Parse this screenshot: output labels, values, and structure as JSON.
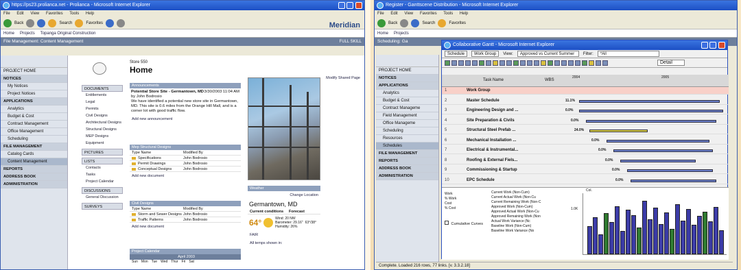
{
  "left_window": {
    "title": "https://ps23.prolianca.net - Prolianca - Microsoft Internet Explorer",
    "menu": [
      "File",
      "Edit",
      "View",
      "Favorites",
      "Tools",
      "Help"
    ],
    "toolbar": {
      "back": "Back",
      "search": "Search",
      "favorites": "Favorites"
    },
    "links": [
      "Home",
      "Projects",
      "Topanga Original Construction"
    ],
    "brand": "Meridian",
    "nav_strip": "File Management: Content Management",
    "nav_right": "FULL SKILL",
    "sidebar": [
      {
        "label": "PROJECT HOME",
        "type": "item"
      },
      {
        "label": "NOTICES",
        "type": "hdr"
      },
      {
        "label": "My Notices",
        "type": "sub"
      },
      {
        "label": "Project Notices",
        "type": "sub"
      },
      {
        "label": "APPLICATIONS",
        "type": "hdr"
      },
      {
        "label": "Analytics",
        "type": "sub"
      },
      {
        "label": "Budget & Cost",
        "type": "sub"
      },
      {
        "label": "Contract Management",
        "type": "sub"
      },
      {
        "label": "Office Management",
        "type": "sub"
      },
      {
        "label": "Scheduling",
        "type": "sub"
      },
      {
        "label": "FILE MANAGEMENT",
        "type": "hdr"
      },
      {
        "label": "Catalog Cards",
        "type": "sub"
      },
      {
        "label": "Content Management",
        "type": "sel"
      },
      {
        "label": "REPORTS",
        "type": "hdr"
      },
      {
        "label": "ADDRESS BOOK",
        "type": "hdr"
      },
      {
        "label": "ADMINISTRATION",
        "type": "hdr"
      }
    ],
    "page_sub": "Store 550",
    "page_title": "Home",
    "modify": "Modify Shared Page",
    "left_nav": [
      {
        "label": "DOCUMENTS",
        "sec": true
      },
      {
        "label": "Entitlements",
        "sec": false
      },
      {
        "label": "Legal",
        "sec": false
      },
      {
        "label": "Permits",
        "sec": false
      },
      {
        "label": "Civil Designs",
        "sec": false
      },
      {
        "label": "Architectural Designs",
        "sec": false
      },
      {
        "label": "Structural Designs",
        "sec": false
      },
      {
        "label": "MEP Designs",
        "sec": false
      },
      {
        "label": "Equipment",
        "sec": false
      },
      {
        "label": "PICTURES",
        "sec": true
      },
      {
        "label": "LISTS",
        "sec": true
      },
      {
        "label": "Contacts",
        "sec": false
      },
      {
        "label": "Tasks",
        "sec": false
      },
      {
        "label": "Project Calendar",
        "sec": false
      },
      {
        "label": "DISCUSSIONS",
        "sec": true
      },
      {
        "label": "General Discussion",
        "sec": false
      },
      {
        "label": "SURVEYS",
        "sec": true
      }
    ],
    "announce": {
      "header": "Announcements",
      "title": "Potential Store Site - Germantown, MD",
      "date": "3/30/2003 11:04 AM",
      "by": "by John Bodrosio",
      "body": "We have identified a potential new store site in Germantown, MD. This site is 0.6 miles from the Orange Hill Mall, and is a corner lot with good traffic flow.",
      "add": "Add new announcement"
    },
    "structural": {
      "header": "Mep Structural Designs",
      "col1": "Type  Name",
      "col2": "Modified By",
      "rows": [
        {
          "name": "Specifications",
          "by": "John Bodrosio"
        },
        {
          "name": "Permit Drawings",
          "by": "John Bodrosio"
        },
        {
          "name": "Conceptual Designs",
          "by": "John Bodrosio"
        }
      ],
      "add": "Add new document"
    },
    "civil": {
      "header": "Civil Designs",
      "col1": "Type  Name",
      "col2": "Modified By",
      "rows": [
        {
          "name": "Storm and Sewer Designs",
          "by": "John Bodrosio"
        },
        {
          "name": "Traffic Patterns",
          "by": "John Bodrosio"
        }
      ],
      "add": "Add new document"
    },
    "calendar": {
      "header": "Project Calendar",
      "month": "April 2003",
      "days": [
        "Sun",
        "Mon",
        "Tue",
        "Wed",
        "Thur",
        "Fri",
        "Sat"
      ]
    },
    "weather": {
      "header": "Weather",
      "change": "Change Location",
      "city": "Germantown, MD",
      "current": "Current conditions",
      "forecast": "Forecast",
      "temp": "64°",
      "cond": "FAIR",
      "wind": "Wind: 20 NW",
      "barometer": "Barometer: 29.16\"",
      "humidity": "Humidity: 26%",
      "hilo": "63°/38°",
      "shown_in": "All temps shown in:"
    }
  },
  "right_window": {
    "title": "Register - Ganttscene Distribution - Microsoft Internet Explorer",
    "inner_title": "Collaborative Gantt - Microsoft Internet Explorer",
    "links": [
      "Home",
      "Projects"
    ],
    "nav_strip": "Scheduling: Ga",
    "sidebar": [
      {
        "label": "PROJECT HOME",
        "type": "item"
      },
      {
        "label": "NOTICES",
        "type": "hdr"
      },
      {
        "label": "APPLICATIONS",
        "type": "hdr"
      },
      {
        "label": "Analytics",
        "type": "sub"
      },
      {
        "label": "Budget & Cost",
        "type": "sub"
      },
      {
        "label": "Contract Manageme",
        "type": "sub"
      },
      {
        "label": "Field Management",
        "type": "sub"
      },
      {
        "label": "Office Manageme",
        "type": "sub"
      },
      {
        "label": "Scheduling",
        "type": "sub"
      },
      {
        "label": "Resources",
        "type": "sub"
      },
      {
        "label": "Schedules",
        "type": "sel"
      },
      {
        "label": "FILE MANAGEMENT",
        "type": "hdr"
      },
      {
        "label": "REPORTS",
        "type": "hdr"
      },
      {
        "label": "ADDRESS BOOK",
        "type": "hdr"
      },
      {
        "label": "ADMINISTRATION",
        "type": "hdr"
      }
    ],
    "gantt_toolbar": {
      "schedule": "Schedule",
      "group": "Work Group",
      "view_label": "View:",
      "view_value": "Approved vs Current Summer",
      "filter_label": "Filter:",
      "filter_value": "*All",
      "detail": "Detail"
    },
    "task_col": "Task Name",
    "wbs_col": "WBS",
    "years": [
      "2004",
      "2005"
    ],
    "tasks": [
      {
        "n": "1",
        "name": "Work Group",
        "pct": ""
      },
      {
        "n": "2",
        "name": "Master Schedule",
        "pct": "11.1%"
      },
      {
        "n": "3",
        "name": "Engineering Design and ...",
        "pct": "0.0%"
      },
      {
        "n": "4",
        "name": "Site Preparation & Civils",
        "pct": "0.0%"
      },
      {
        "n": "5",
        "name": "Structural Steel Prefab ...",
        "pct": "24.0%"
      },
      {
        "n": "6",
        "name": "Mechanical Installation ...",
        "pct": "0.0%"
      },
      {
        "n": "7",
        "name": "Electrical & Instrumental...",
        "pct": "0.0%"
      },
      {
        "n": "8",
        "name": "Roofing & External Fiels...",
        "pct": "0.0%"
      },
      {
        "n": "9",
        "name": "Commissioning & Startup",
        "pct": "0.0%"
      },
      {
        "n": "10",
        "name": "EPC Schedule",
        "pct": "0.0%"
      }
    ],
    "legend_rows": [
      "Work",
      "% Work",
      "Cost",
      "% Cost"
    ],
    "cumulative": "Cumulative Curves",
    "series_list": [
      "Current Work (Non-Cum)",
      "Current Actual Work (Non-Cu",
      "Current Remaining Work (Non-C",
      "Approved Work (Non-Cum)",
      "Approved Actual Work (Non-Cu",
      "Approved Remaining Work (Non",
      "Actual Work Variance (Nc",
      "Baseline Work (Non-Cum)",
      "Baseline Work Variance (No"
    ],
    "hist_labels": [
      "1.0K",
      "Col."
    ],
    "histogram": [
      42,
      55,
      30,
      61,
      48,
      72,
      35,
      66,
      58,
      40,
      80,
      52,
      70,
      45,
      62,
      38,
      75,
      50,
      68,
      44,
      57,
      63,
      49,
      71,
      36
    ],
    "status": "Complete. Loaded 216 rows, 77 links. [v. 3.3.2.18]"
  }
}
